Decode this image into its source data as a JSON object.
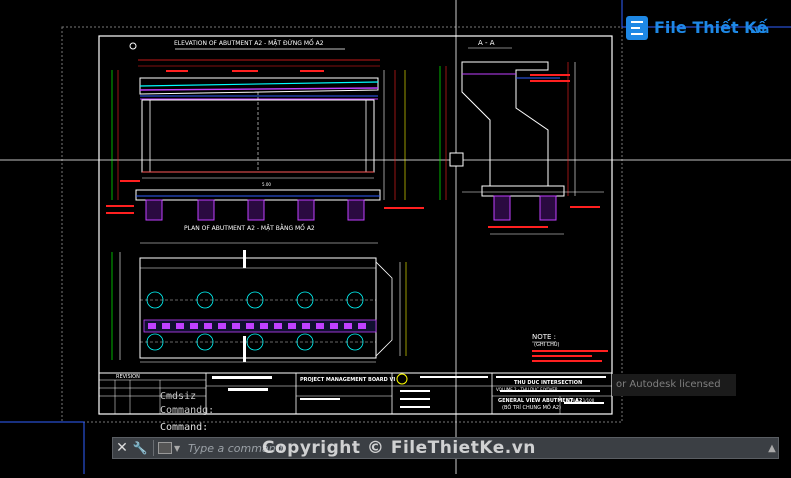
{
  "drawing": {
    "elevation_title": "ELEVATION OF ABUTMENT A2 - MẶT ĐỨNG MỐ A2",
    "plan_title": "PLAN OF ABUTMENT A2 - MẶT BẰNG MỐ A2",
    "section_title": "A - A",
    "note_title": "NOTE :",
    "note_sub": "(GHI CHÚ)",
    "revision_label": "REVISION",
    "project_title": "PROJECT MANAGEMENT BOARD VI",
    "intersection_title": "THU DUC INTERSECTION",
    "volume_label": "VOLUME 2 - THU DUC FLYOVER",
    "sheet_title": "GENERAL VIEW ABUTMENT A2",
    "sheet_subtitle": "(BỐ TRÍ CHUNG MỐ A2)",
    "scale_label": "SCALE : 1/100"
  },
  "command_line": {
    "history": [
      "Cmdsiz",
      "Commandg:",
      "Command:"
    ],
    "placeholder": "Type a command"
  },
  "licensed_text": "or Autodesk licensed",
  "watermark": "Copyright © FileThietKe.vn",
  "logo": {
    "text": "File Thiết Kế",
    "suffix": ".vn"
  },
  "colors": {
    "background": "#000000",
    "frame": "#ffffff",
    "accent_red": "#ff2020",
    "accent_magenta": "#c040ff",
    "accent_cyan": "#00ffff",
    "accent_yellow": "#ffff00",
    "accent_green": "#00ff00",
    "accent_blue": "#3060ff",
    "logo_blue": "#1e88e5"
  }
}
